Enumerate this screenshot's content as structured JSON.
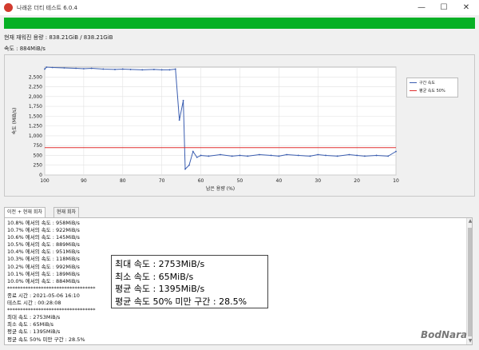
{
  "app": {
    "title": "나래온 더티 테스트 6.0.4"
  },
  "window_controls": {
    "minimize": "—",
    "maximize": "☐",
    "close": "✕"
  },
  "progress": {
    "value": 1.0,
    "color": "#06b025"
  },
  "info": {
    "written": "현재 재워진 용량 : 838.21GiB / 838.21GiB",
    "speed": "속도 : 884MiB/s"
  },
  "chart_data": {
    "type": "line",
    "xlabel": "남은 용량 (%)",
    "ylabel": "속도 (MiB/s)",
    "xlim": [
      100,
      10
    ],
    "ylim": [
      0,
      2750
    ],
    "x_ticks": [
      "100",
      "90",
      "80",
      "70",
      "60",
      "50",
      "40",
      "30",
      "20",
      "10"
    ],
    "y_ticks": [
      "0",
      "250",
      "500",
      "750",
      "1,000",
      "1,250",
      "1,500",
      "1,750",
      "2,000",
      "2,250",
      "2,500"
    ],
    "grid": true,
    "legend_position": "right",
    "series": [
      {
        "name": "구간 속도",
        "color": "#3a5db0",
        "x": [
          100,
          99.5,
          98,
          95,
          92,
          90,
          88,
          85,
          82,
          80,
          78,
          75,
          72,
          70,
          68,
          66.5,
          65.5,
          64.5,
          64,
          63,
          62,
          61,
          60,
          58,
          55,
          52,
          50,
          48,
          45,
          42,
          40,
          38,
          35,
          32,
          30,
          28,
          25,
          22,
          20,
          18,
          15,
          12,
          10
        ],
        "values": [
          2700,
          2750,
          2740,
          2730,
          2720,
          2710,
          2720,
          2700,
          2690,
          2700,
          2690,
          2680,
          2690,
          2680,
          2680,
          2700,
          1400,
          1900,
          150,
          250,
          600,
          450,
          500,
          480,
          520,
          480,
          500,
          480,
          520,
          500,
          480,
          520,
          500,
          480,
          520,
          500,
          480,
          520,
          500,
          480,
          500,
          480,
          600
        ]
      },
      {
        "name": "평균 속도 50%",
        "color": "#e03030",
        "value": 698
      }
    ]
  },
  "tabs": [
    {
      "label": "이전 + 현재 회차",
      "active": true
    },
    {
      "label": "현재 회차",
      "active": false
    }
  ],
  "log_lines": [
    "10.8% 에서의 속도 : 958MiB/s",
    "10.7% 에서의 속도 : 922MiB/s",
    "10.6% 에서의 속도 : 145MiB/s",
    "10.5% 에서의 속도 : 889MiB/s",
    "10.4% 에서의 속도 : 951MiB/s",
    "10.3% 에서의 속도 : 118MiB/s",
    "10.2% 에서의 속도 : 992MiB/s",
    "10.1% 에서의 속도 : 189MiB/s",
    "10.0% 에서의 속도 : 884MiB/s",
    "**********************************",
    "종료 시간 : 2021-05-06 16:10",
    "테스트 시간 : 00:28:08",
    "**********************************",
    "최대 속도 : 2753MiB/s",
    "최소 속도 : 65MiB/s",
    "평균 속도 : 1395MiB/s",
    "평균 속도 50% 미만 구간 : 28.5%",
    "**********************************"
  ],
  "stats": {
    "max": "최대 속도 : 2753MiB/s",
    "min": "최소 속도 : 65MiB/s",
    "avg": "평균 속도 : 1395MiB/s",
    "below50": "평균 속도 50% 미만 구간 : 28.5%"
  },
  "watermark": "BodNara"
}
